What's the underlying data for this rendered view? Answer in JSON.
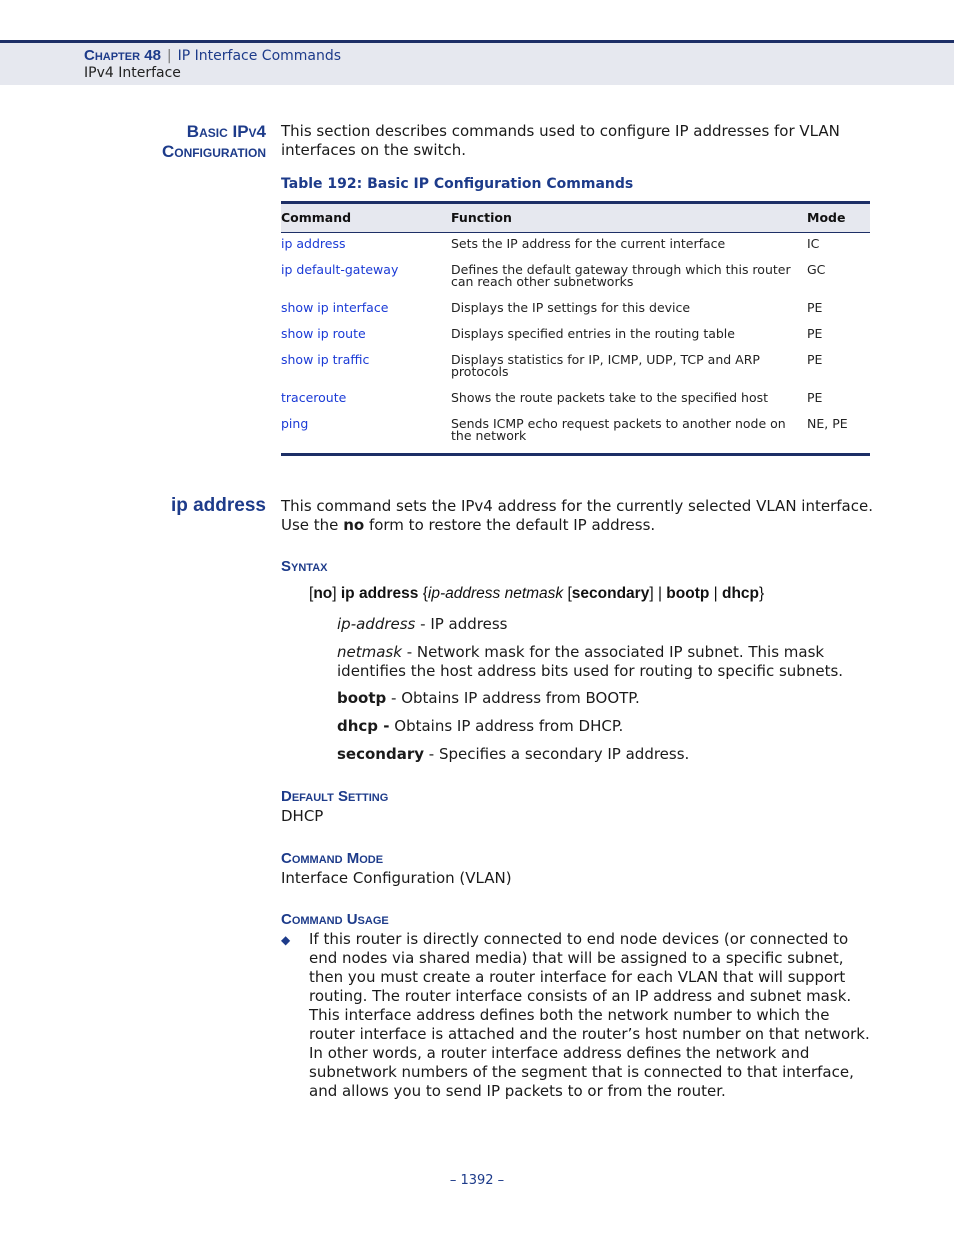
{
  "header": {
    "chapter": "Chapter 48",
    "separator": "|",
    "chapter_title": "IP Interface Commands",
    "subtitle": "IPv4 Interface"
  },
  "section1": {
    "heading_line1": "Basic IPv4",
    "heading_line2": "Configuration",
    "intro": "This section describes commands used to configure IP addresses for VLAN interfaces on the switch."
  },
  "table": {
    "caption": "Table 192: Basic IP Configuration Commands",
    "headers": [
      "Command",
      "Function",
      "Mode"
    ],
    "rows": [
      {
        "command": "ip address",
        "function": "Sets the IP address for the current interface",
        "mode": "IC"
      },
      {
        "command": "ip default-gateway",
        "function": "Defines the default gateway through which this router can reach other subnetworks",
        "mode": "GC"
      },
      {
        "command": "show ip interface",
        "function": "Displays the IP settings for this device",
        "mode": "PE"
      },
      {
        "command": "show ip route",
        "function": "Displays specified entries in the routing table",
        "mode": "PE"
      },
      {
        "command": "show ip traffic",
        "function": "Displays statistics for IP, ICMP, UDP, TCP and ARP protocols",
        "mode": "PE"
      },
      {
        "command": "traceroute",
        "function": "Shows the route packets take to the specified host",
        "mode": "PE"
      },
      {
        "command": "ping",
        "function": "Sends ICMP echo request packets to another node on the network",
        "mode": "NE, PE"
      }
    ]
  },
  "section2": {
    "heading": "ip address",
    "desc_part1": "This command sets the IPv4 address for the currently selected VLAN interface. Use the ",
    "desc_bold": "no",
    "desc_part2": " form to restore the default IP address.",
    "syntax_heading": "Syntax",
    "syntax": {
      "b1": "[",
      "no": "no",
      "b2": "] ",
      "cmd": "ip address",
      "s1": " {",
      "ip_address": "ip-address",
      "s2": " ",
      "netmask": "netmask",
      "s3": " [",
      "secondary": "secondary",
      "s4": "] | ",
      "bootp": "bootp",
      "s5": " | ",
      "dhcp": "dhcp",
      "s6": "}"
    },
    "params": [
      {
        "term": "ip-address",
        "desc": " - IP address"
      },
      {
        "term": "netmask",
        "desc": " - Network mask for the associated IP subnet. This mask identifies the host address bits used for routing to specific subnets."
      },
      {
        "term": "bootp",
        "desc": " - Obtains IP address from BOOTP."
      },
      {
        "term": "dhcp -",
        "desc": " Obtains IP address from DHCP."
      },
      {
        "term": "secondary",
        "desc": " - Specifies a secondary IP address."
      }
    ],
    "default_heading": "Default Setting",
    "default_value": "DHCP",
    "mode_heading": "Command Mode",
    "mode_value": "Interface Configuration (VLAN)",
    "usage_heading": "Command Usage",
    "usage_bullets": [
      "If this router is directly connected to end node devices (or connected to end nodes via shared media) that will be assigned to a specific subnet, then you must create a router interface for each VLAN that will support routing. The router interface consists of an IP address and subnet mask. This interface address defines both the network number to which the router interface is attached and the router’s host number on that network. In other words, a router interface address defines the network and subnetwork numbers of the segment that is connected to that interface, and allows you to send IP packets to or from the router."
    ]
  },
  "footer": {
    "page_number": "–  1392  –"
  }
}
